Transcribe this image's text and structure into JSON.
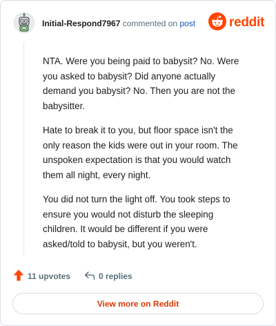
{
  "header": {
    "username": "Initial-Respond7967",
    "commented_text": "commented on",
    "post_link": "post",
    "brand_name": "reddit",
    "avatar_icon": "robot-avatar-icon",
    "brand_icon": "reddit-snoo-icon"
  },
  "comment": {
    "paragraphs": [
      "NTA. Were you being paid to babysit? No. Were you asked to babysit? Did anyone actually demand you babysit? No. Then you are not the babysitter.",
      "Hate to break it to you, but floor space isn't the only reason the kids were out in your room. The unspoken expectation is that you would watch them all night, every night.",
      "You did not turn the light off. You took steps to ensure you would not disturb the sleeping children. It would be different if you were asked/told to babysit, but you weren't."
    ]
  },
  "actions": {
    "upvotes_label": "11 upvotes",
    "replies_label": "0 replies",
    "upvote_icon": "upvote-arrow-icon",
    "reply_icon": "reply-arrow-icon"
  },
  "footer": {
    "view_more_label": "View more on Reddit"
  },
  "colors": {
    "brand": "#ff4500",
    "link": "#0a54c2",
    "muted": "#576f76",
    "button_text": "#d93900"
  }
}
